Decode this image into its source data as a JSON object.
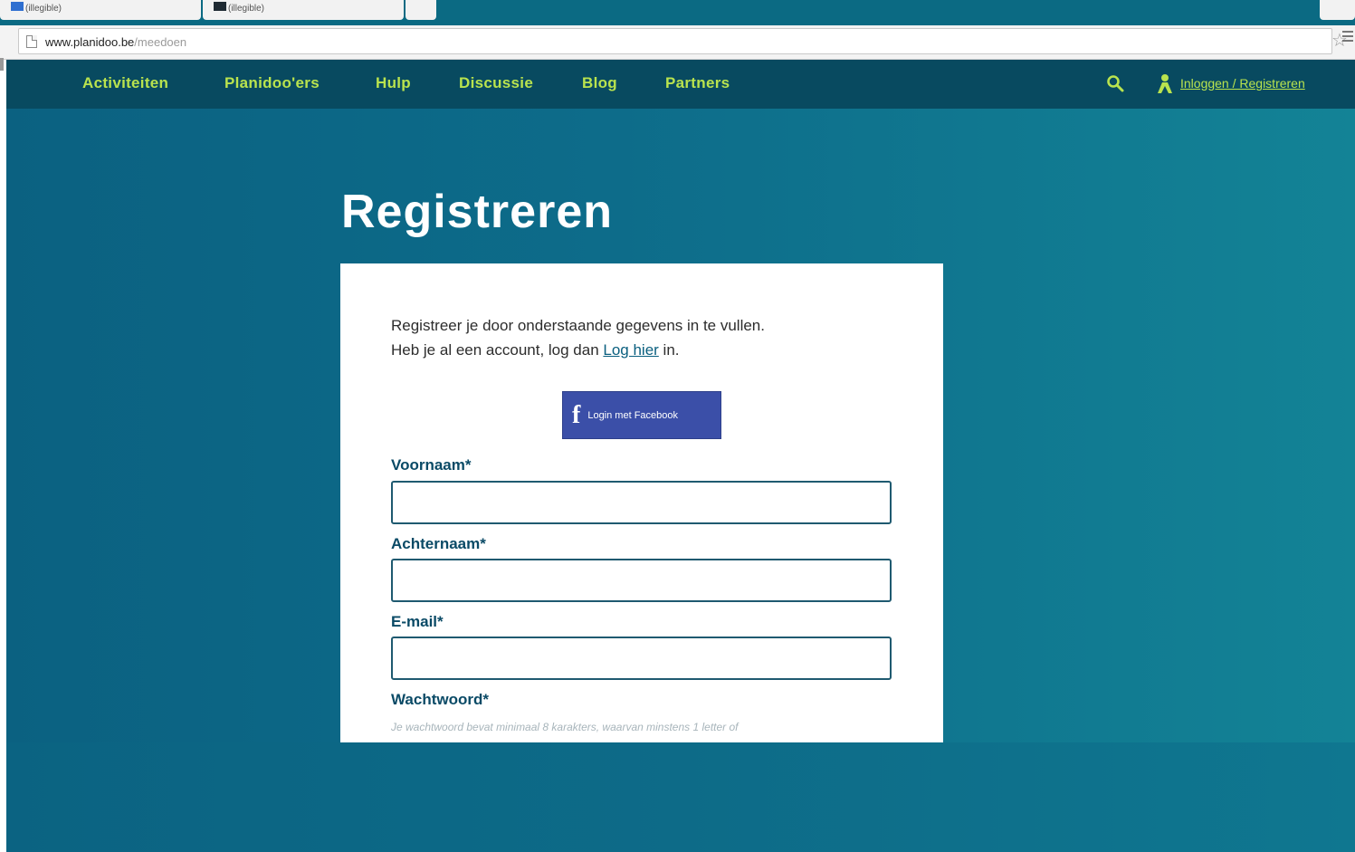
{
  "browser": {
    "tabs": [
      {
        "label": "(illegible)",
        "favicon_color": "#2f6fd0"
      },
      {
        "label": "(illegible)",
        "favicon_color": "#1f2a33"
      },
      {
        "label": ""
      },
      {
        "label": ""
      }
    ],
    "url_host": "www.planidoo.be",
    "url_path": "/meedoen"
  },
  "nav": {
    "items": [
      "Activiteiten",
      "Planidoo'ers",
      "Hulp",
      "Discussie",
      "Blog",
      "Partners"
    ],
    "login_label": "Inloggen / Registreren",
    "accent_color": "#b9e34e"
  },
  "page": {
    "title": "Registreren"
  },
  "form": {
    "intro_line1": "Registreer je door onderstaande gegevens in te vullen.",
    "intro_line2_pre": "Heb je al een account, log dan ",
    "intro_link": "Log hier",
    "intro_line2_post": " in.",
    "facebook_button": "Login met Facebook",
    "fields": [
      {
        "label": "Voornaam*",
        "value": ""
      },
      {
        "label": "Achternaam*",
        "value": ""
      },
      {
        "label": "E-mail*",
        "value": ""
      },
      {
        "label": "Wachtwoord*"
      }
    ],
    "password_hint": "Je wachtwoord bevat minimaal 8 karakters, waarvan minstens 1 letter of"
  }
}
